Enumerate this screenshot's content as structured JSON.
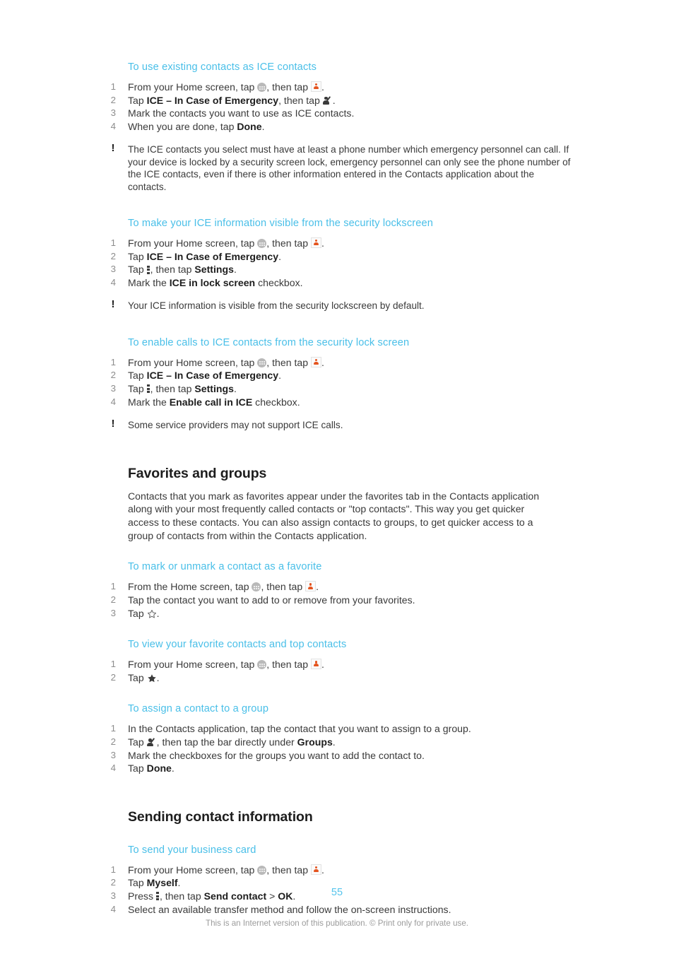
{
  "document": {
    "page_number": "55",
    "footer_note": "This is an Internet version of this publication. © Print only for private use.",
    "accent_color": "#49bfe8",
    "page_number_color": "#55c4ec",
    "body_color": "#3a3a3a",
    "step_number_color": "#8d8d8d"
  },
  "procedures": {
    "use_existing_contacts": {
      "title": "To use existing contacts as ICE contacts",
      "steps": {
        "s1_a": "From your Home screen, tap",
        "s1_b": ", then tap",
        "s1_c": ".",
        "s2_a": "Tap",
        "s2_bold": "ICE – In Case of Emergency",
        "s2_b": ", then tap",
        "s2_c": ".",
        "s3": "Mark the contacts you want to use as ICE contacts.",
        "s4_a": "When you are done, tap",
        "s4_bold": "Done",
        "s4_c": "."
      },
      "note": "The ICE contacts you select must have at least a phone number which emergency personnel can call. If your device is locked by a security screen lock, emergency personnel can only see the phone number of the ICE contacts, even if there is other information entered in the Contacts application about the contacts."
    },
    "make_ice_visible": {
      "title": "To make your ICE information visible from the security lockscreen",
      "steps": {
        "s1_a": "From your Home screen, tap",
        "s1_b": ", then tap",
        "s1_c": ".",
        "s2_a": "Tap",
        "s2_bold": "ICE – In Case of Emergency",
        "s2_c": ".",
        "s3_a": "Tap",
        "s3_b": ", then tap",
        "s3_bold": "Settings",
        "s3_c": ".",
        "s4_a": "Mark the",
        "s4_bold": "ICE in lock screen",
        "s4_c": "checkbox."
      },
      "note": "Your ICE information is visible from the security lockscreen by default."
    },
    "enable_calls": {
      "title": "To enable calls to ICE contacts from the security lock screen",
      "steps": {
        "s1_a": "From your Home screen, tap",
        "s1_b": ", then tap",
        "s1_c": ".",
        "s2_a": "Tap",
        "s2_bold": "ICE – In Case of Emergency",
        "s2_c": ".",
        "s3_a": "Tap",
        "s3_b": ", then tap",
        "s3_bold": "Settings",
        "s3_c": ".",
        "s4_a": "Mark the",
        "s4_bold": "Enable call in ICE",
        "s4_c": "checkbox."
      },
      "note": "Some service providers may not support ICE calls."
    },
    "mark_favorite": {
      "title": "To mark or unmark a contact as a favorite",
      "steps": {
        "s1_a": "From the Home screen, tap",
        "s1_b": ", then tap",
        "s1_c": ".",
        "s2": "Tap the contact you want to add to or remove from your favorites.",
        "s3_a": "Tap",
        "s3_c": "."
      }
    },
    "view_favorites": {
      "title": "To view your favorite contacts and top contacts",
      "steps": {
        "s1_a": "From your Home screen, tap",
        "s1_b": ", then tap",
        "s1_c": ".",
        "s2_a": "Tap",
        "s2_c": "."
      }
    },
    "assign_group": {
      "title": "To assign a contact to a group",
      "steps": {
        "s1": "In the Contacts application, tap the contact that you want to assign to a group.",
        "s2_a": "Tap",
        "s2_b": ", then tap the bar directly under",
        "s2_bold": "Groups",
        "s2_c": ".",
        "s3": "Mark the checkboxes for the groups you want to add the contact to.",
        "s4_a": "Tap",
        "s4_bold": "Done",
        "s4_c": "."
      }
    },
    "send_business_card": {
      "title": "To send your business card",
      "steps": {
        "s1_a": "From your Home screen, tap",
        "s1_b": ", then tap",
        "s1_c": ".",
        "s2_a": "Tap",
        "s2_bold": "Myself",
        "s2_c": ".",
        "s3_a": "Press",
        "s3_b": ", then tap",
        "s3_bold": "Send contact",
        "s3_gt": ">",
        "s3_bold2": "OK",
        "s3_c": ".",
        "s4": "Select an available transfer method and follow the on-screen instructions."
      }
    }
  },
  "sections": {
    "favorites_and_groups": {
      "heading": "Favorites and groups",
      "body": "Contacts that you mark as favorites appear under the favorites tab in the Contacts application along with your most frequently called contacts or \"top contacts\". This way you get quicker access to these contacts. You can also assign contacts to groups, to get quicker access to a group of contacts from within the Contacts application."
    },
    "sending_contact_information": {
      "heading": "Sending contact information"
    }
  },
  "icons": {
    "app_drawer": "app-drawer-icon",
    "contacts": "contacts-app-icon",
    "person_edit": "person-edit-icon",
    "overflow_menu": "overflow-menu-icon",
    "star_outline": "star-outline-icon",
    "star_filled": "star-filled-icon",
    "note_marker": "!"
  }
}
